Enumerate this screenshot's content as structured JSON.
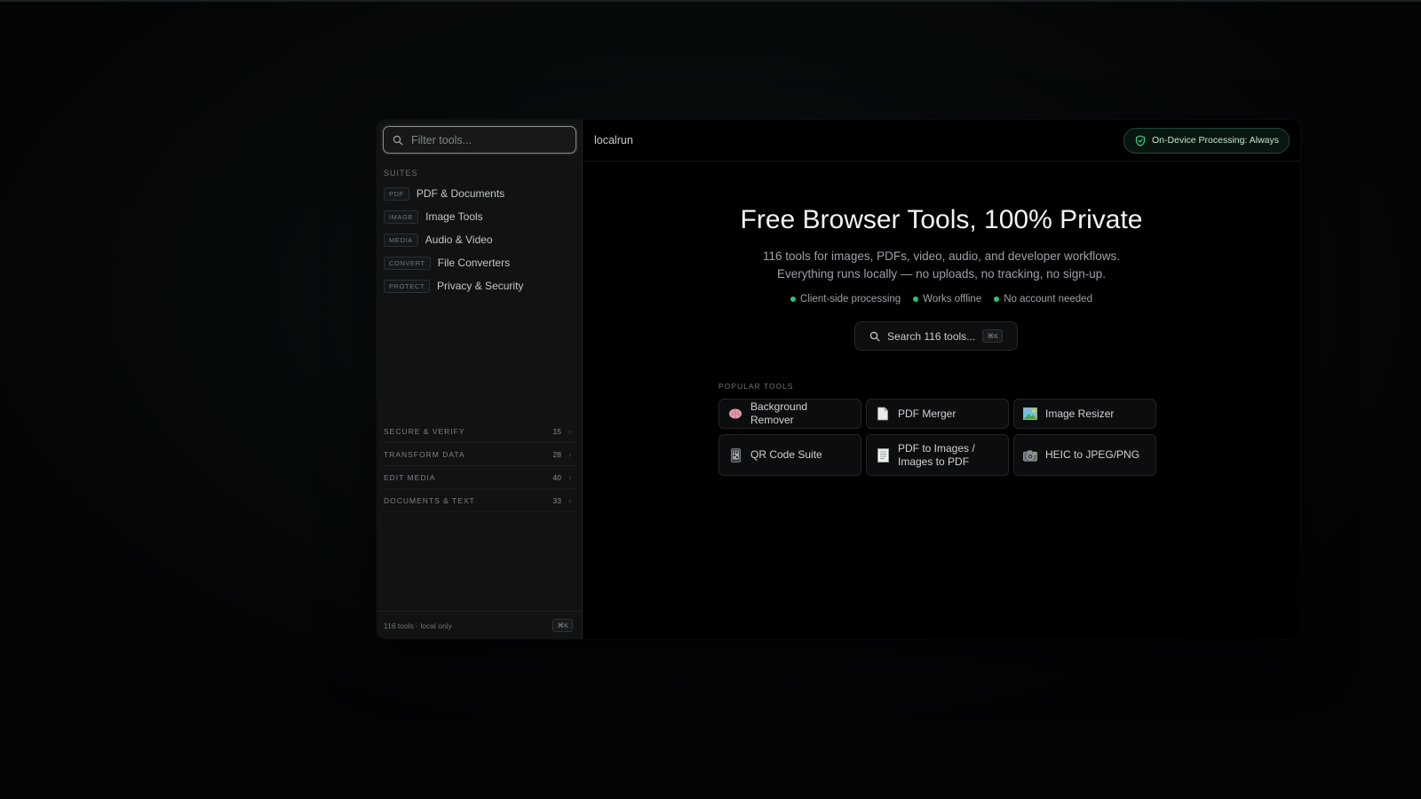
{
  "sidebar": {
    "filter_placeholder": "Filter tools...",
    "suites_label": "SUITES",
    "suites": [
      {
        "tag": "PDF",
        "label": "PDF & Documents"
      },
      {
        "tag": "IMAGE",
        "label": "Image Tools"
      },
      {
        "tag": "MEDIA",
        "label": "Audio & Video"
      },
      {
        "tag": "CONVERT",
        "label": "File Converters"
      },
      {
        "tag": "PROTECT",
        "label": "Privacy & Security"
      }
    ],
    "categories": [
      {
        "label": "SECURE & VERIFY",
        "count": "15"
      },
      {
        "label": "TRANSFORM DATA",
        "count": "28"
      },
      {
        "label": "EDIT MEDIA",
        "count": "40"
      },
      {
        "label": "DOCUMENTS & TEXT",
        "count": "33"
      }
    ],
    "footer_text": "116 tools · local only",
    "footer_shortcut": "⌘K"
  },
  "header": {
    "brand": "localrun",
    "badge": "On-Device Processing: Always"
  },
  "hero": {
    "title": "Free Browser Tools, 100% Private",
    "subtitle_line1": "116 tools for images, PDFs, video, audio, and developer workflows.",
    "subtitle_line2": "Everything runs locally — no uploads, no tracking, no sign-up.",
    "features": [
      "Client-side processing",
      "Works offline",
      "No account needed"
    ],
    "search_label": "Search 116 tools...",
    "search_shortcut": "⌘K"
  },
  "popular": {
    "label": "POPULAR TOOLS",
    "tools": [
      {
        "label": "Background Remover",
        "icon": "brain-icon"
      },
      {
        "label": "PDF Merger",
        "icon": "document-icon"
      },
      {
        "label": "Image Resizer",
        "icon": "picture-icon"
      },
      {
        "label": "QR Code Suite",
        "icon": "phone-icon"
      },
      {
        "label": "PDF to Images / Images to PDF",
        "icon": "page-icon"
      },
      {
        "label": "HEIC to JPEG/PNG",
        "icon": "camera-icon"
      }
    ]
  },
  "colors": {
    "accent_green": "#2fbf7a",
    "background": "#000000",
    "sidebar": "#101213"
  }
}
